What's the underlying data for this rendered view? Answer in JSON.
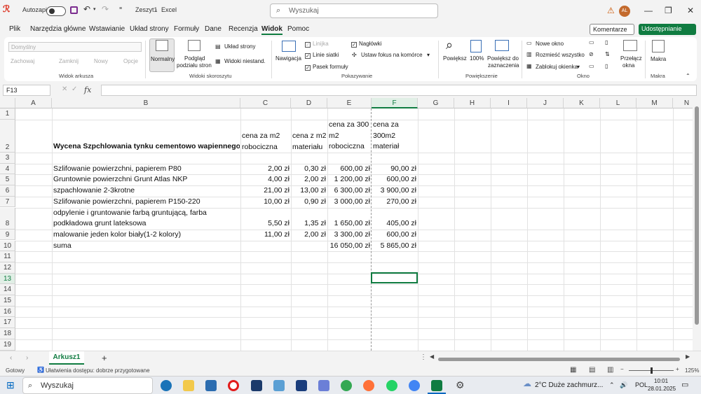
{
  "titlebar": {
    "autosave_label": "Autozapis",
    "doc_title": "Zeszyt1",
    "app_name": "Excel",
    "title_sep": "-",
    "search_placeholder": "Wyszukaj",
    "user_initials": "AL"
  },
  "menu": {
    "tabs": [
      "Plik",
      "Narzędzia główne",
      "Wstawianie",
      "Układ strony",
      "Formuły",
      "Dane",
      "Recenzja",
      "Widok",
      "Pomoc"
    ],
    "active": "Widok",
    "comments_label": "Komentarze",
    "share_label": "Udostępnianie"
  },
  "ribbon": {
    "sheet_view": {
      "dropdown": "Domyślny",
      "keep": "Zachowaj",
      "exit": "Zamknij",
      "new": "Nowy",
      "options": "Opcje",
      "group": "Widok arkusza"
    },
    "workbook_views": {
      "normal": "Normalny",
      "page_break_1": "Podgląd",
      "page_break_2": "podziału stron",
      "page_layout": "Układ strony",
      "custom": "Widoki niestand.",
      "group": "Widoki skoroszytu"
    },
    "show": {
      "navigation": "Nawigacja",
      "ruler": "Linijka",
      "gridlines": "Linie siatki",
      "formula_bar": "Pasek formuły",
      "headings": "Nagłówki",
      "focus_cell": "Ustaw fokus na komórce",
      "group": "Pokazywanie"
    },
    "zoom": {
      "zoom": "Powiększ",
      "hundred": "100%",
      "to_selection_1": "Powiększ do",
      "to_selection_2": "zaznaczenia",
      "group": "Powiększenie"
    },
    "window": {
      "new_window": "Nowe okno",
      "arrange_all": "Rozmieść wszystko",
      "freeze": "Zablokuj okienka",
      "switch_1": "Przełącz",
      "switch_2": "okna",
      "group": "Okno"
    },
    "macros": {
      "label": "Makra",
      "group": "Makra"
    }
  },
  "formula_bar": {
    "name_box": "F13",
    "fx": "fx",
    "value": ""
  },
  "grid": {
    "columns": [
      "A",
      "B",
      "C",
      "D",
      "E",
      "F",
      "G",
      "H",
      "I",
      "J",
      "K",
      "L",
      "M",
      "N"
    ],
    "selected_column": "F",
    "rows": [
      "1",
      "2",
      "3",
      "4",
      "5",
      "6",
      "7",
      "8",
      "9",
      "10",
      "11",
      "12",
      "13",
      "14",
      "15",
      "16",
      "17",
      "18",
      "19"
    ],
    "selected_row": "13",
    "header": {
      "title": "Wycena Szpchlowania tynku cementowo wapiennego",
      "c": "cena za m2 robociczna",
      "d": "cena z m2 materiału",
      "e": "cena za 300 m2 robociczna",
      "f": "cena za 300m2 materiał"
    },
    "items": [
      {
        "row": 4,
        "b": "Szlifowanie powierzchni, papierem P80",
        "c": "2,00 zł",
        "d": "0,30 zł",
        "e": "600,00 zł",
        "f": "90,00 zł"
      },
      {
        "row": 5,
        "b": "Gruntownie powierzchni Grunt Atlas NKP",
        "c": "4,00 zł",
        "d": "2,00 zł",
        "e": "1 200,00 zł",
        "f": "600,00 zł"
      },
      {
        "row": 6,
        "b": "szpachlowanie 2-3krotne",
        "c": "21,00 zł",
        "d": "13,00 zł",
        "e": "6 300,00 zł",
        "f": "3 900,00 zł"
      },
      {
        "row": 7,
        "b": "Szlifowanie powierzchni, papierem P150-220",
        "c": "10,00 zł",
        "d": "0,90 zł",
        "e": "3 000,00 zł",
        "f": "270,00 zł"
      },
      {
        "row": 8,
        "b": "odpylenie i gruntowanie farbą gruntującą, farba podkładowa grunt lateksowa",
        "c": "5,50 zł",
        "d": "1,35 zł",
        "e": "1 650,00 zł",
        "f": "405,00 zł"
      },
      {
        "row": 9,
        "b": "malowanie jeden kolor biały(1-2 kolory)",
        "c": "11,00 zł",
        "d": "2,00 zł",
        "e": "3 300,00 zł",
        "f": "600,00 zł"
      },
      {
        "row": 10,
        "b": "suma",
        "c": "",
        "d": "",
        "e": "16 050,00 zł",
        "f": "5 865,00 zł"
      }
    ]
  },
  "sheets": {
    "active": "Arkusz1"
  },
  "statusbar": {
    "ready": "Gotowy",
    "accessibility": "Ułatwienia dostępu: dobrze przygotowane",
    "zoom": "125%"
  },
  "taskbar": {
    "search": "Wyszukaj",
    "weather": "2°C  Duże zachmurz...",
    "lang": "POL",
    "time": "10:01",
    "date": "28.01.2025"
  },
  "colors": {
    "accent": "#107c41",
    "selected_header_bg": "#e1efe6"
  }
}
